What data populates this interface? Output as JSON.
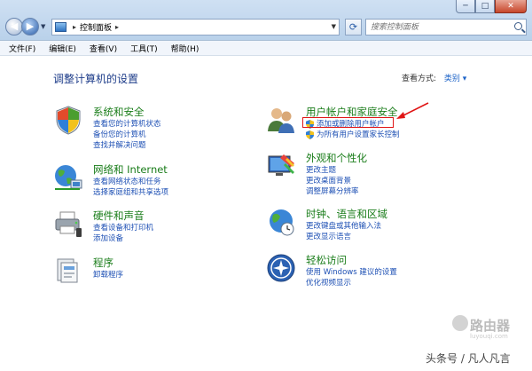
{
  "window": {
    "min": "─",
    "max": "□",
    "close": "✕"
  },
  "address": {
    "path": "控制面板",
    "search_placeholder": "搜索控制面板"
  },
  "menu": [
    "文件(F)",
    "编辑(E)",
    "查看(V)",
    "工具(T)",
    "帮助(H)"
  ],
  "page": {
    "heading": "调整计算机的设置",
    "view_label": "查看方式:",
    "view_value": "类别"
  },
  "categories": [
    {
      "title": "系统和安全",
      "links": [
        "查看您的计算机状态",
        "备份您的计算机",
        "查找并解决问题"
      ]
    },
    {
      "title": "网络和 Internet",
      "links": [
        "查看网络状态和任务",
        "选择家庭组和共享选项"
      ]
    },
    {
      "title": "硬件和声音",
      "links": [
        "查看设备和打印机",
        "添加设备"
      ]
    },
    {
      "title": "程序",
      "links": [
        "卸载程序"
      ]
    },
    {
      "title": "用户帐户和家庭安全",
      "links": [
        "添加或删除用户帐户",
        "为所有用户设置家长控制"
      ]
    },
    {
      "title": "外观和个性化",
      "links": [
        "更改主题",
        "更改桌面背景",
        "调整屏幕分辨率"
      ]
    },
    {
      "title": "时钟、语言和区域",
      "links": [
        "更改键盘或其他输入法",
        "更改显示语言"
      ]
    },
    {
      "title": "轻松访问",
      "links": [
        "使用 Windows 建议的设置",
        "优化视频显示"
      ]
    }
  ],
  "watermark": {
    "brand": "路由器",
    "domain": "luyouqi.com",
    "author": "头条号 / 凡人凡言"
  },
  "colors": {
    "link": "#1e50b4",
    "category": "#1a7d1a",
    "highlight": "#e01515"
  }
}
